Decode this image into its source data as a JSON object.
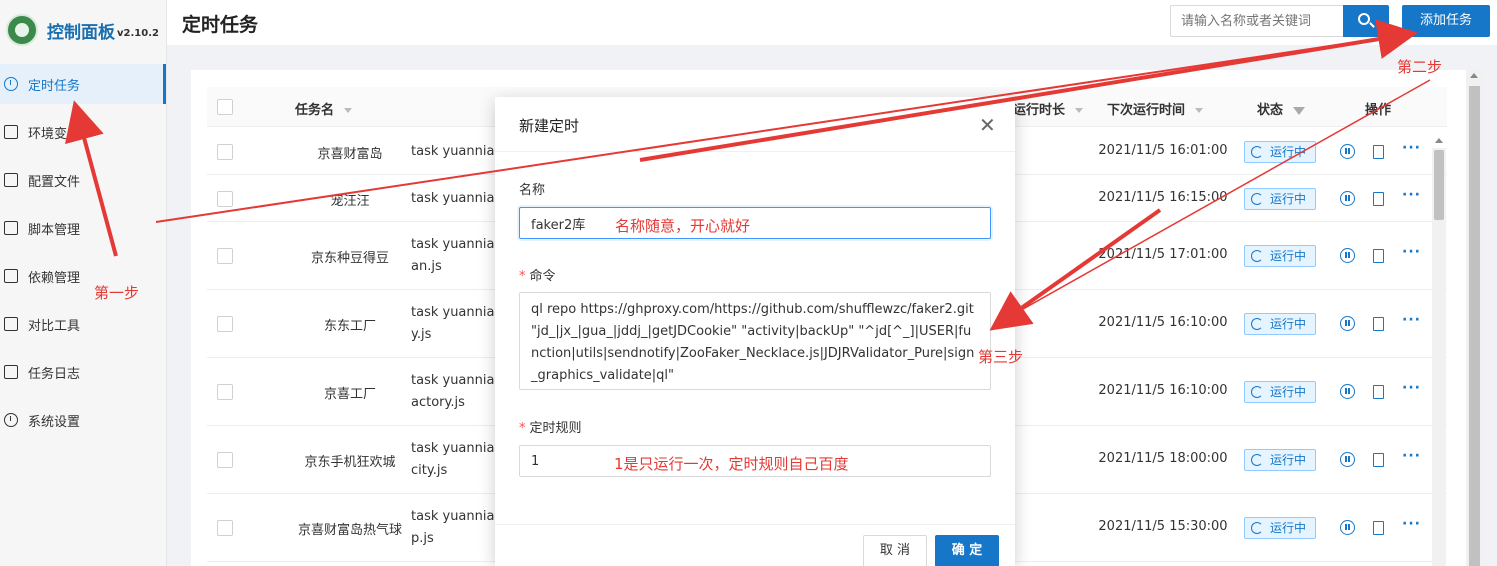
{
  "app": {
    "title": "控制面板",
    "version": "v2.10.2",
    "page_title": "定时任务"
  },
  "sidebar": {
    "items": [
      {
        "label": "定时任务",
        "icon": "clock-icon",
        "active": true
      },
      {
        "label": "环境变量",
        "icon": "variable-icon"
      },
      {
        "label": "配置文件",
        "icon": "config-icon"
      },
      {
        "label": "脚本管理",
        "icon": "edit-icon"
      },
      {
        "label": "依赖管理",
        "icon": "package-icon"
      },
      {
        "label": "对比工具",
        "icon": "diff-icon"
      },
      {
        "label": "任务日志",
        "icon": "folder-icon"
      },
      {
        "label": "系统设置",
        "icon": "gear-icon"
      }
    ]
  },
  "header": {
    "search_placeholder": "请输入名称或者关键词",
    "add_label": "添加任务"
  },
  "table": {
    "columns": {
      "name": "任务名",
      "duration": "运行时长",
      "next_run": "下次运行时间",
      "status": "状态",
      "actions": "操作"
    },
    "rows": [
      {
        "name": "京喜财富岛",
        "command": "task yuannian",
        "next_run": "2021/11/5 16:01:00",
        "status": "运行中"
      },
      {
        "name": "宠汪汪",
        "command": "task yuannian",
        "next_run": "2021/11/5 16:15:00",
        "status": "运行中"
      },
      {
        "name": "京东种豆得豆",
        "command": "task yuannian\nan.js",
        "next_run": "2021/11/5 17:01:00",
        "status": "运行中"
      },
      {
        "name": "东东工厂",
        "command": "task yuannian\ny.js",
        "next_run": "2021/11/5 16:10:00",
        "status": "运行中"
      },
      {
        "name": "京喜工厂",
        "command": "task yuannian\nactory.js",
        "next_run": "2021/11/5 16:10:00",
        "status": "运行中"
      },
      {
        "name": "京东手机狂欢城",
        "command": "task yuannian\ncity.js",
        "next_run": "2021/11/5 18:00:00",
        "status": "运行中"
      },
      {
        "name": "京喜财富岛热气球",
        "command": "task yuannian\np.js",
        "next_run": "2021/11/5 15:30:00",
        "status": "运行中"
      }
    ]
  },
  "modal": {
    "title": "新建定时",
    "name_label": "名称",
    "name_value": "faker2库",
    "command_label": "命令",
    "command_value": "ql repo https://ghproxy.com/https://github.com/shufflewzc/faker2.git \"jd_|jx_|gua_|jddj_|getJDCookie\" \"activity|backUp\" \"^jd[^_]|USER|function|utils|sendnotify|ZooFaker_Necklace.js|JDJRValidator_Pure|sign_graphics_validate|ql\"",
    "cron_label": "定时规则",
    "cron_value": "1",
    "cancel_label": "取 消",
    "ok_label": "确 定"
  },
  "annotations": {
    "step1": "第一步",
    "step2": "第二步",
    "step3": "第三步",
    "name_hint": "名称随意，开心就好",
    "cron_hint": "1是只运行一次，定时规则自己百度"
  },
  "colors": {
    "primary": "#1677c9",
    "annotation": "#e53935"
  }
}
